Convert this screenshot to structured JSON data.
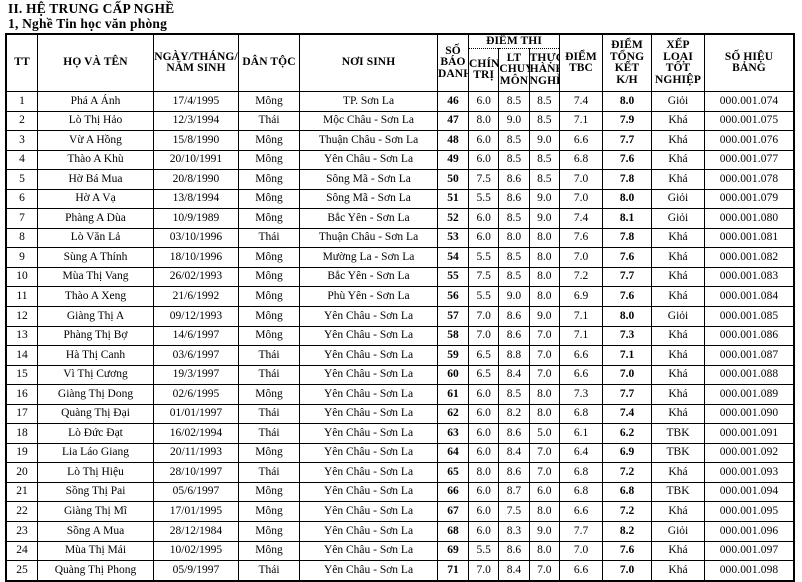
{
  "title": {
    "line1": "II. HỆ TRUNG CẤP NGHỀ",
    "line2": "1, Nghề Tin học văn phòng"
  },
  "table": {
    "headers": {
      "tt": "TT",
      "name": "HỌ VÀ TÊN",
      "dob": "NGÀY/THÁNG/ NĂM SINH",
      "dob_line1": "NGÀY/THÁNG/",
      "dob_line2": "NĂM SINH",
      "dantoc": "DÂN TỘC",
      "noisinh": "NƠI SINH",
      "sbd_line1": "SỐ",
      "sbd_line2": "BÁO",
      "sbd_line3": "DANH",
      "diemthi_group": "ĐIỂM THI",
      "chinhtri_line1": "CHÍNH",
      "chinhtri_line2": "TRỊ",
      "ltcm_line1": "LT",
      "ltcm_line2": "CHUYÊN",
      "ltcm_line3": "MÔN",
      "thn_line1": "THỰC",
      "thn_line2": "HÀNH",
      "thn_line3": "NGHỀ",
      "tbc_line1": "ĐIỂM",
      "tbc_line2": "TBC",
      "tong_line1": "ĐIỂM",
      "tong_line2": "TỔNG",
      "tong_line3": "KẾT",
      "tong_line4": "K/H",
      "xep_line1": "XẾP",
      "xep_line2": "LOẠI",
      "xep_line3": "TỐT",
      "xep_line4": "NGHIỆP",
      "shb_line1": "SỐ HIỆU",
      "shb_line2": "BẢNG"
    },
    "rows": [
      {
        "tt": "1",
        "name": "Phá A Ánh",
        "dob": "17/4/1995",
        "dantoc": "Mông",
        "noisinh": "TP. Sơn La",
        "sbd": "46",
        "ct": "6.0",
        "lt": "8.5",
        "th": "8.5",
        "tbc": "7.4",
        "tong": "8.0",
        "xep": "Giỏi",
        "shb": "000.001.074"
      },
      {
        "tt": "2",
        "name": "Lò Thị Hảo",
        "dob": "12/3/1994",
        "dantoc": "Thái",
        "noisinh": "Mộc Châu - Sơn La",
        "sbd": "47",
        "ct": "8.0",
        "lt": "9.0",
        "th": "8.5",
        "tbc": "7.1",
        "tong": "7.9",
        "xep": "Khá",
        "shb": "000.001.075"
      },
      {
        "tt": "3",
        "name": "Vừ A Hồng",
        "dob": "15/8/1990",
        "dantoc": "Mông",
        "noisinh": "Thuận Châu - Sơn La",
        "sbd": "48",
        "ct": "6.0",
        "lt": "8.5",
        "th": "9.0",
        "tbc": "6.6",
        "tong": "7.7",
        "xep": "Khá",
        "shb": "000.001.076"
      },
      {
        "tt": "4",
        "name": "Thào A Khù",
        "dob": "20/10/1991",
        "dantoc": "Mông",
        "noisinh": "Yên Châu - Sơn La",
        "sbd": "49",
        "ct": "6.0",
        "lt": "8.5",
        "th": "8.5",
        "tbc": "6.8",
        "tong": "7.6",
        "xep": "Khá",
        "shb": "000.001.077"
      },
      {
        "tt": "5",
        "name": "Hờ Bá Mua",
        "dob": "20/8/1990",
        "dantoc": "Mông",
        "noisinh": "Sông Mã - Sơn La",
        "sbd": "50",
        "ct": "7.5",
        "lt": "8.6",
        "th": "8.5",
        "tbc": "7.0",
        "tong": "7.8",
        "xep": "Khá",
        "shb": "000.001.078"
      },
      {
        "tt": "6",
        "name": "Hờ A Vạ",
        "dob": "13/8/1994",
        "dantoc": "Mông",
        "noisinh": "Sông Mã - Sơn La",
        "sbd": "51",
        "ct": "5.5",
        "lt": "8.6",
        "th": "9.0",
        "tbc": "7.0",
        "tong": "8.0",
        "xep": "Giỏi",
        "shb": "000.001.079"
      },
      {
        "tt": "7",
        "name": "Phàng A Dùa",
        "dob": "10/9/1989",
        "dantoc": "Mông",
        "noisinh": "Bắc Yên - Sơn La",
        "sbd": "52",
        "ct": "6.0",
        "lt": "8.5",
        "th": "9.0",
        "tbc": "7.4",
        "tong": "8.1",
        "xep": "Giỏi",
        "shb": "000.001.080"
      },
      {
        "tt": "8",
        "name": "Lò Văn Lả",
        "dob": "03/10/1996",
        "dantoc": "Thái",
        "noisinh": "Thuận Châu - Sơn La",
        "sbd": "53",
        "ct": "6.0",
        "lt": "8.0",
        "th": "8.0",
        "tbc": "7.6",
        "tong": "7.8",
        "xep": "Khá",
        "shb": "000.001.081"
      },
      {
        "tt": "9",
        "name": "Sùng A Thính",
        "dob": "18/10/1996",
        "dantoc": "Mông",
        "noisinh": "Mường La - Sơn La",
        "sbd": "54",
        "ct": "5.5",
        "lt": "8.5",
        "th": "8.0",
        "tbc": "7.0",
        "tong": "7.6",
        "xep": "Khá",
        "shb": "000.001.082"
      },
      {
        "tt": "10",
        "name": "Mùa Thị Vang",
        "dob": "26/02/1993",
        "dantoc": "Mông",
        "noisinh": "Bắc Yên - Sơn La",
        "sbd": "55",
        "ct": "7.5",
        "lt": "8.5",
        "th": "8.0",
        "tbc": "7.2",
        "tong": "7.7",
        "xep": "Khá",
        "shb": "000.001.083"
      },
      {
        "tt": "11",
        "name": "Thào A Xeng",
        "dob": "21/6/1992",
        "dantoc": "Mông",
        "noisinh": "Phù Yên - Sơn La",
        "sbd": "56",
        "ct": "5.5",
        "lt": "9.0",
        "th": "8.0",
        "tbc": "6.9",
        "tong": "7.6",
        "xep": "Khá",
        "shb": "000.001.084"
      },
      {
        "tt": "12",
        "name": "Giàng Thị A",
        "dob": "09/12/1993",
        "dantoc": "Mông",
        "noisinh": "Yên Châu - Sơn La",
        "sbd": "57",
        "ct": "7.0",
        "lt": "8.6",
        "th": "9.0",
        "tbc": "7.1",
        "tong": "8.0",
        "xep": "Giỏi",
        "shb": "000.001.085"
      },
      {
        "tt": "13",
        "name": "Phàng Thị Bợ",
        "dob": "14/6/1997",
        "dantoc": "Mông",
        "noisinh": "Yên Châu - Sơn La",
        "sbd": "58",
        "ct": "7.0",
        "lt": "8.6",
        "th": "7.0",
        "tbc": "7.1",
        "tong": "7.3",
        "xep": "Khá",
        "shb": "000.001.086"
      },
      {
        "tt": "14",
        "name": "Hà Thị Canh",
        "dob": "03/6/1997",
        "dantoc": "Thái",
        "noisinh": "Yên Châu - Sơn La",
        "sbd": "59",
        "ct": "6.5",
        "lt": "8.8",
        "th": "7.0",
        "tbc": "6.6",
        "tong": "7.1",
        "xep": "Khá",
        "shb": "000.001.087"
      },
      {
        "tt": "15",
        "name": "Vì Thị Cương",
        "dob": "19/3/1997",
        "dantoc": "Thái",
        "noisinh": "Yên Châu - Sơn La",
        "sbd": "60",
        "ct": "6.5",
        "lt": "8.4",
        "th": "7.0",
        "tbc": "6.6",
        "tong": "7.0",
        "xep": "Khá",
        "shb": "000.001.088"
      },
      {
        "tt": "16",
        "name": "Giàng Thị Dong",
        "dob": "02/6/1995",
        "dantoc": "Mông",
        "noisinh": "Yên Châu - Sơn La",
        "sbd": "61",
        "ct": "6.0",
        "lt": "8.5",
        "th": "8.0",
        "tbc": "7.3",
        "tong": "7.7",
        "xep": "Khá",
        "shb": "000.001.089"
      },
      {
        "tt": "17",
        "name": "Quàng Thị Đại",
        "dob": "01/01/1997",
        "dantoc": "Thái",
        "noisinh": "Yên Châu - Sơn La",
        "sbd": "62",
        "ct": "6.0",
        "lt": "8.2",
        "th": "8.0",
        "tbc": "6.8",
        "tong": "7.4",
        "xep": "Khá",
        "shb": "000.001.090"
      },
      {
        "tt": "18",
        "name": "Lò Đức Đạt",
        "dob": "16/02/1994",
        "dantoc": "Thái",
        "noisinh": "Yên Châu - Sơn La",
        "sbd": "63",
        "ct": "6.0",
        "lt": "8.6",
        "th": "5.0",
        "tbc": "6.1",
        "tong": "6.2",
        "xep": "TBK",
        "shb": "000.001.091"
      },
      {
        "tt": "19",
        "name": "Lia Láo Giang",
        "dob": "20/11/1993",
        "dantoc": "Mông",
        "noisinh": "Yên Châu - Sơn La",
        "sbd": "64",
        "ct": "6.0",
        "lt": "8.4",
        "th": "7.0",
        "tbc": "6.4",
        "tong": "6.9",
        "xep": "TBK",
        "shb": "000.001.092"
      },
      {
        "tt": "20",
        "name": "Lò Thị Hiệu",
        "dob": "28/10/1997",
        "dantoc": "Thái",
        "noisinh": "Yên Châu - Sơn La",
        "sbd": "65",
        "ct": "8.0",
        "lt": "8.6",
        "th": "7.0",
        "tbc": "6.8",
        "tong": "7.2",
        "xep": "Khá",
        "shb": "000.001.093"
      },
      {
        "tt": "21",
        "name": "Sồng Thị  Pai",
        "dob": "05/6/1997",
        "dantoc": "Mông",
        "noisinh": "Yên Châu - Sơn La",
        "sbd": "66",
        "ct": "6.0",
        "lt": "8.7",
        "th": "6.0",
        "tbc": "6.8",
        "tong": "6.8",
        "xep": "TBK",
        "shb": "000.001.094"
      },
      {
        "tt": "22",
        "name": "Giàng Thị  Mĩ",
        "dob": "17/01/1995",
        "dantoc": "Mông",
        "noisinh": "Yên Châu - Sơn La",
        "sbd": "67",
        "ct": "6.0",
        "lt": "7.5",
        "th": "8.0",
        "tbc": "6.6",
        "tong": "7.2",
        "xep": "Khá",
        "shb": "000.001.095"
      },
      {
        "tt": "23",
        "name": "Sồng A Mua",
        "dob": "28/12/1984",
        "dantoc": "Mông",
        "noisinh": "Yên Châu - Sơn La",
        "sbd": "68",
        "ct": "6.0",
        "lt": "8.3",
        "th": "9.0",
        "tbc": "7.7",
        "tong": "8.2",
        "xep": "Giỏi",
        "shb": "000.001.096"
      },
      {
        "tt": "24",
        "name": "Mùa Thị Mái",
        "dob": "10/02/1995",
        "dantoc": "Mông",
        "noisinh": "Yên Châu - Sơn La",
        "sbd": "69",
        "ct": "5.5",
        "lt": "8.6",
        "th": "8.0",
        "tbc": "7.0",
        "tong": "7.6",
        "xep": "Khá",
        "shb": "000.001.097"
      },
      {
        "tt": "25",
        "name": "Quàng Thị Phong",
        "dob": "05/9/1997",
        "dantoc": "Thái",
        "noisinh": "Yên Châu - Sơn La",
        "sbd": "71",
        "ct": "7.0",
        "lt": "8.4",
        "th": "7.0",
        "tbc": "6.6",
        "tong": "7.0",
        "xep": "Khá",
        "shb": "000.001.098"
      }
    ]
  }
}
